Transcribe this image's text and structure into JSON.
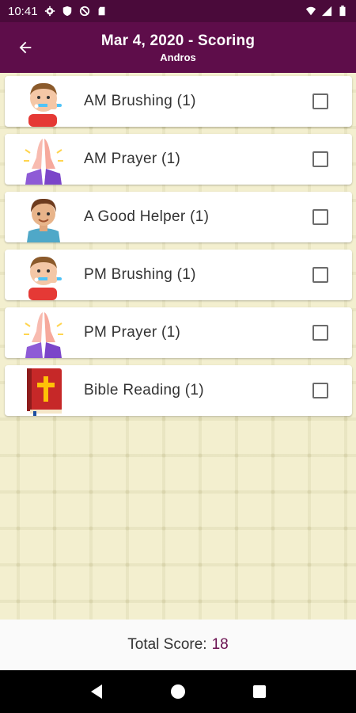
{
  "status": {
    "time": "10:41"
  },
  "header": {
    "title": "Mar 4, 2020 - Scoring",
    "subtitle": "Andros"
  },
  "tasks": [
    {
      "label": "AM Brushing (1)",
      "image": "child-brushing-teeth-icon",
      "checked": false
    },
    {
      "label": "AM Prayer (1)",
      "image": "praying-hands-icon",
      "checked": false
    },
    {
      "label": "A Good Helper (1)",
      "image": "boy-helper-icon",
      "checked": false
    },
    {
      "label": "PM Brushing (1)",
      "image": "child-brushing-teeth-icon",
      "checked": false
    },
    {
      "label": "PM Prayer (1)",
      "image": "praying-hands-icon",
      "checked": false
    },
    {
      "label": "Bible Reading (1)",
      "image": "bible-icon",
      "checked": false
    }
  ],
  "footer": {
    "total_label": "Total Score:",
    "total_value": "18"
  },
  "colors": {
    "status_bar": "#4a0a3a",
    "app_bar": "#5e0d4a",
    "background": "#f3efcf",
    "score_accent": "#6a1050"
  }
}
